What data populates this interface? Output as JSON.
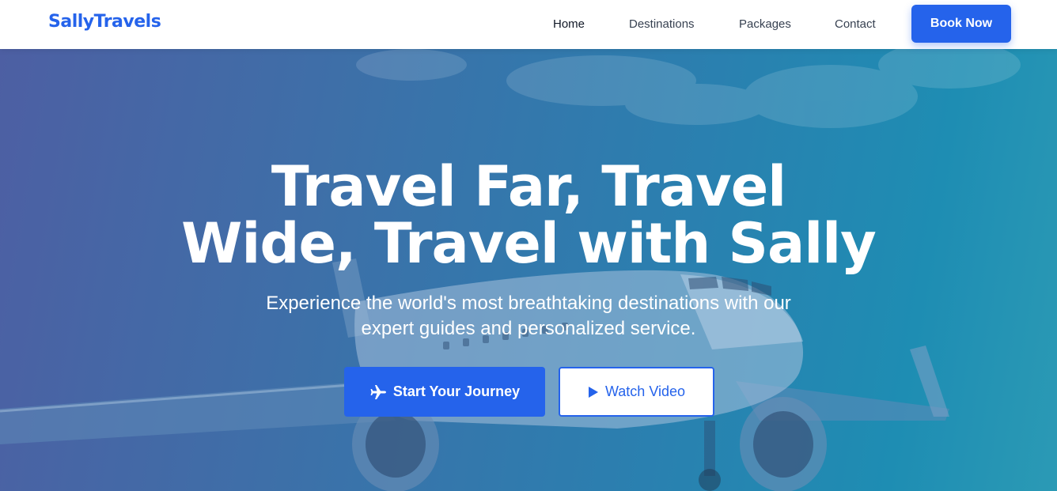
{
  "brand": {
    "name": "SallyTravels"
  },
  "nav": {
    "links": [
      {
        "label": "Home",
        "active": true
      },
      {
        "label": "Destinations"
      },
      {
        "label": "Packages"
      },
      {
        "label": "Contact"
      }
    ],
    "cta_label": "Book Now"
  },
  "hero": {
    "title_line1": "Travel Far, Travel",
    "title_line2": "Wide, Travel with Sally",
    "subtitle": "Experience the world's most breathtaking destinations with our expert guides and personalized service.",
    "primary_button": {
      "label": "Start Your Journey",
      "icon": "plane-icon"
    },
    "secondary_button": {
      "label": "Watch Video",
      "icon": "play-icon"
    }
  },
  "colors": {
    "accent": "#2563eb",
    "nav_text": "#374151",
    "hero_overlay_left": "#4d5fa3",
    "hero_overlay_right": "#2b9ab5"
  }
}
